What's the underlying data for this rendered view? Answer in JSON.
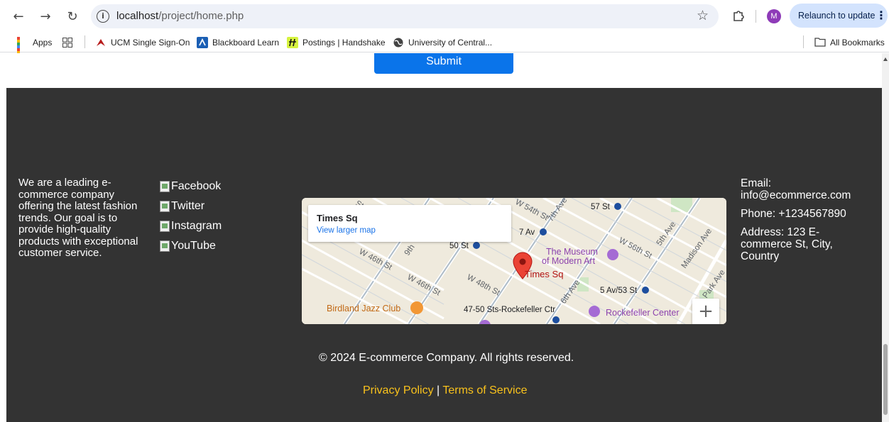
{
  "browser": {
    "url_host": "localhost",
    "url_path": "/project/home.php",
    "profile_initial": "M",
    "relaunch_label": "Relaunch to update"
  },
  "bookmarks": {
    "apps": "Apps",
    "items": [
      {
        "label": "UCM Single Sign-On"
      },
      {
        "label": "Blackboard Learn"
      },
      {
        "label": "Postings | Handshake"
      },
      {
        "label": "University of Central..."
      }
    ],
    "all_bookmarks": "All Bookmarks"
  },
  "form": {
    "submit_label": "Submit"
  },
  "footer": {
    "about": "We are a leading e-commerce company offering the latest fashion trends. Our goal is to provide high-quality products with exceptional customer service.",
    "social": [
      {
        "label": "Facebook"
      },
      {
        "label": "Twitter"
      },
      {
        "label": "Instagram"
      },
      {
        "label": "YouTube"
      }
    ],
    "contact": {
      "email": "Email: info@ecommerce.com",
      "phone": "Phone: +1234567890",
      "address": "Address: 123 E-commerce St, City, Country"
    },
    "copyright": "© 2024 E-commerce Company. All rights reserved.",
    "privacy": "Privacy Policy",
    "separator": "|",
    "terms": "Terms of Service"
  },
  "map": {
    "place_title": "Times Sq",
    "view_larger": "View larger map",
    "labels": {
      "w54": "W 54th St",
      "ave7": "7th Ave",
      "st57": "57 St",
      "w56": "W 56th St",
      "ave5": "5th Ave",
      "madison": "Madison Ave",
      "ave7_station": "7 Av",
      "st50": "50 St",
      "museum1": "The Museum",
      "museum2": "of Modern Art",
      "w46a": "W 46th St",
      "ave9": "9th",
      "times_sq": "Times Sq",
      "w46b": "W 46th St",
      "w48": "W 48th St",
      "ave6": "6th Ave",
      "av53": "5 Av/53 St",
      "park": "Park Ave",
      "birdland": "Birdland Jazz Club",
      "rockefeller_station": "47-50 Sts-Rockefeller Ctr",
      "rockefeller": "Rockefeller Center",
      "st": "St"
    },
    "colors": {
      "pin": "#ea4335",
      "poi_purple": "#a56bd4",
      "poi_orange": "#f29735",
      "metro_blue": "#1d4e9e"
    }
  }
}
